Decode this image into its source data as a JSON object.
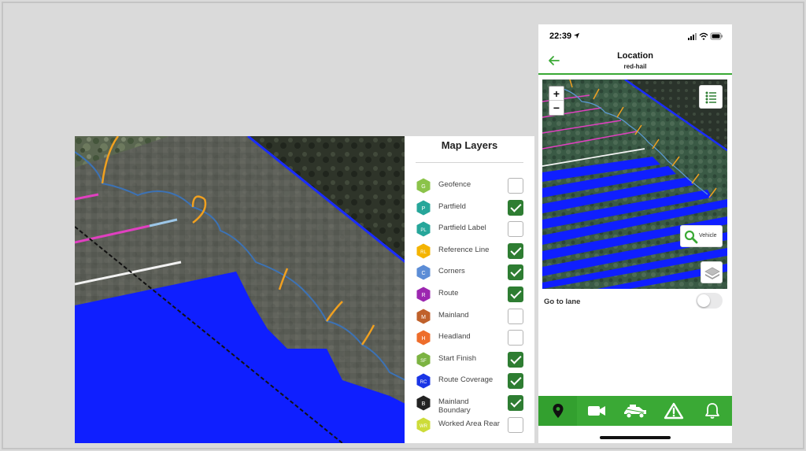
{
  "layers_panel": {
    "title": "Map Layers",
    "items": [
      {
        "label": "Geofence",
        "abbr": "G",
        "color": "#8bc34a",
        "checked": false
      },
      {
        "label": "Partfield",
        "abbr": "P",
        "color": "#26a69a",
        "checked": true
      },
      {
        "label": "Partfield Label",
        "abbr": "PL",
        "color": "#26a69a",
        "checked": false
      },
      {
        "label": "Reference Line",
        "abbr": "RL",
        "color": "#f4b400",
        "checked": true
      },
      {
        "label": "Corners",
        "abbr": "C",
        "color": "#5c8dd6",
        "checked": true
      },
      {
        "label": "Route",
        "abbr": "R",
        "color": "#9c27b0",
        "checked": true
      },
      {
        "label": "Mainland",
        "abbr": "M",
        "color": "#c0612b",
        "checked": false
      },
      {
        "label": "Headland",
        "abbr": "H",
        "color": "#ee6d2b",
        "checked": false
      },
      {
        "label": "Start Finish",
        "abbr": "SF",
        "color": "#7cb342",
        "checked": true
      },
      {
        "label": "Route Coverage",
        "abbr": "RC",
        "color": "#1a35e6",
        "checked": true
      },
      {
        "label": "Mainland Boundary",
        "abbr": "B",
        "color": "#222222",
        "checked": true
      },
      {
        "label": "Worked Area Rear",
        "abbr": "WR",
        "color": "#cddc39",
        "checked": false
      }
    ]
  },
  "phone": {
    "status": {
      "time": "22:39"
    },
    "header": {
      "title": "Location",
      "subtitle": "red-hail"
    },
    "map": {
      "zoom_in": "+",
      "zoom_out": "−",
      "vehicle_label": "Vehicle"
    },
    "goto_lane": {
      "label": "Go to lane",
      "enabled": false
    },
    "tabs": [
      "map-pin-icon",
      "video-camera-icon",
      "tractor-icon",
      "warning-icon",
      "bell-icon"
    ]
  },
  "colors": {
    "brand_green": "#3aa935",
    "coverage_blue": "#1a1aff",
    "check_green": "#2e7d32"
  }
}
